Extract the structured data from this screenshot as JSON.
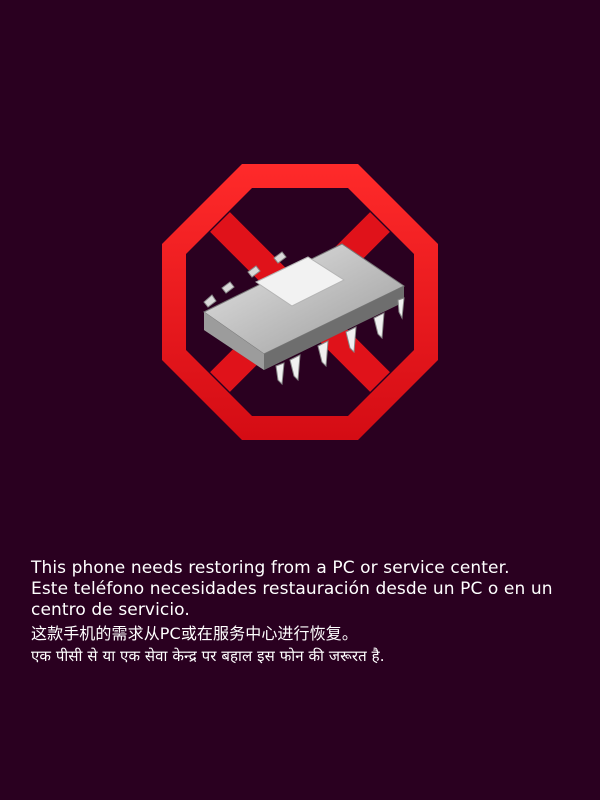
{
  "screen": {
    "background_color": "#2a0020",
    "icon": "prohibited-chip-icon",
    "icon_color": "#ee1c24"
  },
  "message": {
    "english": "This phone needs restoring from a PC or service center.",
    "spanish": "Este teléfono necesidades restauración desde un PC o en un centro de servicio.",
    "chinese": "这款手机的需求从PC或在服务中心进行恢复。",
    "hindi": "एक पीसी से या एक सेवा केन्द्र पर बहाल इस फोन की जरूरत है."
  }
}
